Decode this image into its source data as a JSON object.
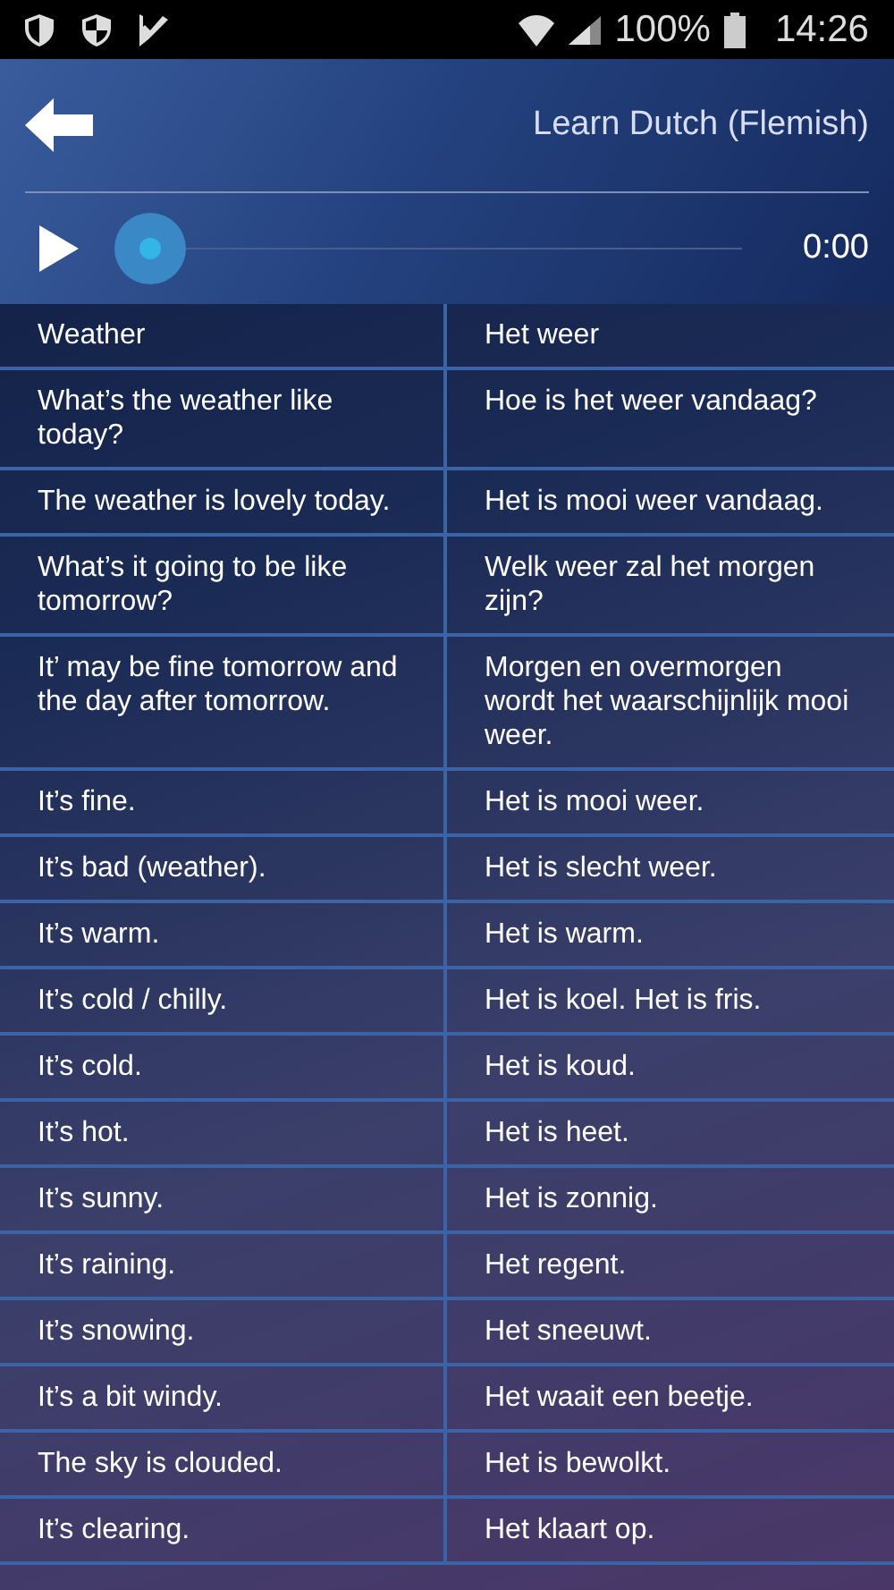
{
  "status_bar": {
    "battery": "100%",
    "time": "14:26"
  },
  "header": {
    "title": "Learn Dutch (Flemish)"
  },
  "player": {
    "time": "0:00"
  },
  "rows": [
    {
      "english": "Weather",
      "dutch": "Het weer"
    },
    {
      "english": "What’s the weather like today?",
      "dutch": "Hoe is het weer vandaag?"
    },
    {
      "english": "The weather is lovely today.",
      "dutch": "Het is mooi weer vandaag."
    },
    {
      "english": "What’s it going to be like tomorrow?",
      "dutch": "Welk weer zal het morgen zijn?"
    },
    {
      "english": "It’ may be fine tomorrow and the day after tomorrow.",
      "dutch": "Morgen en overmorgen wordt het waarschijnlijk mooi weer."
    },
    {
      "english": "It’s fine.",
      "dutch": "Het is mooi weer."
    },
    {
      "english": "It’s bad (weather).",
      "dutch": "Het is slecht weer."
    },
    {
      "english": "It’s warm.",
      "dutch": "Het is warm."
    },
    {
      "english": "It’s cold / chilly.",
      "dutch": "Het is koel. Het is fris."
    },
    {
      "english": "It’s cold.",
      "dutch": "Het is koud."
    },
    {
      "english": "It’s hot.",
      "dutch": "Het is heet."
    },
    {
      "english": "It’s sunny.",
      "dutch": "Het is zonnig."
    },
    {
      "english": "It’s raining.",
      "dutch": "Het regent."
    },
    {
      "english": "It’s snowing.",
      "dutch": "Het sneeuwt."
    },
    {
      "english": "It’s a bit windy.",
      "dutch": "Het waait een beetje."
    },
    {
      "english": "The sky is clouded.",
      "dutch": "Het is bewolkt."
    },
    {
      "english": "It’s clearing.",
      "dutch": "Het klaart op."
    }
  ]
}
